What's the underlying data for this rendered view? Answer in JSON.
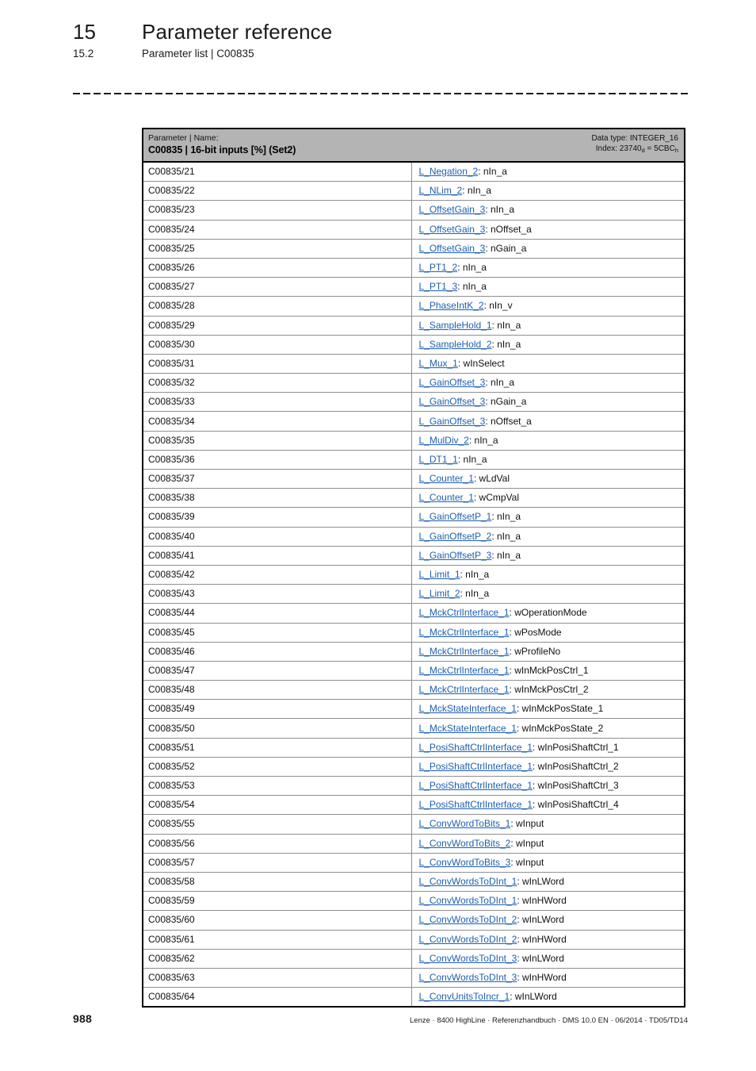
{
  "header": {
    "chapter_number": "15",
    "chapter_title": "Parameter reference",
    "section_number": "15.2",
    "section_title": "Parameter list | C00835"
  },
  "table": {
    "head": {
      "label_small": "Parameter | Name:",
      "label_big": "C00835 | 16-bit inputs [%] (Set2)",
      "data_type": "Data type: INTEGER_16",
      "index_prefix": "Index: 23740",
      "index_sub1": "d",
      "index_mid": " = 5CBC",
      "index_sub2": "h"
    },
    "rows": [
      {
        "param": "C00835/21",
        "link": "L_Negation_2",
        "suffix": ": nIn_a"
      },
      {
        "param": "C00835/22",
        "link": "L_NLim_2",
        "suffix": ": nIn_a"
      },
      {
        "param": "C00835/23",
        "link": "L_OffsetGain_3",
        "suffix": ": nIn_a"
      },
      {
        "param": "C00835/24",
        "link": "L_OffsetGain_3",
        "suffix": ": nOffset_a"
      },
      {
        "param": "C00835/25",
        "link": "L_OffsetGain_3",
        "suffix": ": nGain_a"
      },
      {
        "param": "C00835/26",
        "link": "L_PT1_2",
        "suffix": ": nIn_a"
      },
      {
        "param": "C00835/27",
        "link": "L_PT1_3",
        "suffix": ": nIn_a"
      },
      {
        "param": "C00835/28",
        "link": "L_PhaseIntK_2",
        "suffix": ": nIn_v"
      },
      {
        "param": "C00835/29",
        "link": "L_SampleHold_1",
        "suffix": ": nIn_a"
      },
      {
        "param": "C00835/30",
        "link": "L_SampleHold_2",
        "suffix": ": nIn_a"
      },
      {
        "param": "C00835/31",
        "link": "L_Mux_1",
        "suffix": ": wInSelect"
      },
      {
        "param": "C00835/32",
        "link": "L_GainOffset_3",
        "suffix": ": nIn_a"
      },
      {
        "param": "C00835/33",
        "link": "L_GainOffset_3",
        "suffix": ": nGain_a"
      },
      {
        "param": "C00835/34",
        "link": "L_GainOffset_3",
        "suffix": ": nOffset_a"
      },
      {
        "param": "C00835/35",
        "link": "L_MulDiv_2",
        "suffix": ": nIn_a"
      },
      {
        "param": "C00835/36",
        "link": "L_DT1_1",
        "suffix": ": nIn_a"
      },
      {
        "param": "C00835/37",
        "link": "L_Counter_1",
        "suffix": ": wLdVal"
      },
      {
        "param": "C00835/38",
        "link": "L_Counter_1",
        "suffix": ": wCmpVal"
      },
      {
        "param": "C00835/39",
        "link": "L_GainOffsetP_1",
        "suffix": ": nIn_a"
      },
      {
        "param": "C00835/40",
        "link": "L_GainOffsetP_2",
        "suffix": ": nIn_a"
      },
      {
        "param": "C00835/41",
        "link": "L_GainOffsetP_3",
        "suffix": ": nIn_a"
      },
      {
        "param": "C00835/42",
        "link": "L_Limit_1",
        "suffix": ": nIn_a"
      },
      {
        "param": "C00835/43",
        "link": "L_Limit_2",
        "suffix": ": nIn_a"
      },
      {
        "param": "C00835/44",
        "link": "L_MckCtrlInterface_1",
        "suffix": ": wOperationMode"
      },
      {
        "param": "C00835/45",
        "link": "L_MckCtrlInterface_1",
        "suffix": ": wPosMode"
      },
      {
        "param": "C00835/46",
        "link": "L_MckCtrlInterface_1",
        "suffix": ": wProfileNo"
      },
      {
        "param": "C00835/47",
        "link": "L_MckCtrlInterface_1",
        "suffix": ": wInMckPosCtrl_1"
      },
      {
        "param": "C00835/48",
        "link": "L_MckCtrlInterface_1",
        "suffix": ": wInMckPosCtrl_2"
      },
      {
        "param": "C00835/49",
        "link": "L_MckStateInterface_1",
        "suffix": ": wInMckPosState_1"
      },
      {
        "param": "C00835/50",
        "link": "L_MckStateInterface_1",
        "suffix": ": wInMckPosState_2"
      },
      {
        "param": "C00835/51",
        "link": "L_PosiShaftCtrlInterface_1",
        "suffix": ": wInPosiShaftCtrl_1"
      },
      {
        "param": "C00835/52",
        "link": "L_PosiShaftCtrlInterface_1",
        "suffix": ": wInPosiShaftCtrl_2"
      },
      {
        "param": "C00835/53",
        "link": "L_PosiShaftCtrlInterface_1",
        "suffix": ": wInPosiShaftCtrl_3"
      },
      {
        "param": "C00835/54",
        "link": "L_PosiShaftCtrlInterface_1",
        "suffix": ": wInPosiShaftCtrl_4"
      },
      {
        "param": "C00835/55",
        "link": "L_ConvWordToBits_1",
        "suffix": ": wInput"
      },
      {
        "param": "C00835/56",
        "link": "L_ConvWordToBits_2",
        "suffix": ": wInput"
      },
      {
        "param": "C00835/57",
        "link": "L_ConvWordToBits_3",
        "suffix": ": wInput"
      },
      {
        "param": "C00835/58",
        "link": "L_ConvWordsToDInt_1",
        "suffix": ": wInLWord"
      },
      {
        "param": "C00835/59",
        "link": "L_ConvWordsToDInt_1",
        "suffix": ": wInHWord"
      },
      {
        "param": "C00835/60",
        "link": "L_ConvWordsToDInt_2",
        "suffix": ": wInLWord"
      },
      {
        "param": "C00835/61",
        "link": "L_ConvWordsToDInt_2",
        "suffix": ": wInHWord"
      },
      {
        "param": "C00835/62",
        "link": "L_ConvWordsToDInt_3",
        "suffix": ": wInLWord"
      },
      {
        "param": "C00835/63",
        "link": "L_ConvWordsToDInt_3",
        "suffix": ": wInHWord"
      },
      {
        "param": "C00835/64",
        "link": "L_ConvUnitsToIncr_1",
        "suffix": ": wInLWord"
      }
    ]
  },
  "footer": {
    "page_number": "988",
    "meta": "Lenze · 8400 HighLine · Referenzhandbuch · DMS 10.0 EN · 06/2014 · TD05/TD14"
  },
  "colors": {
    "link": "#1f5faf",
    "header_band": "#b4b4b4",
    "text": "#111111"
  }
}
